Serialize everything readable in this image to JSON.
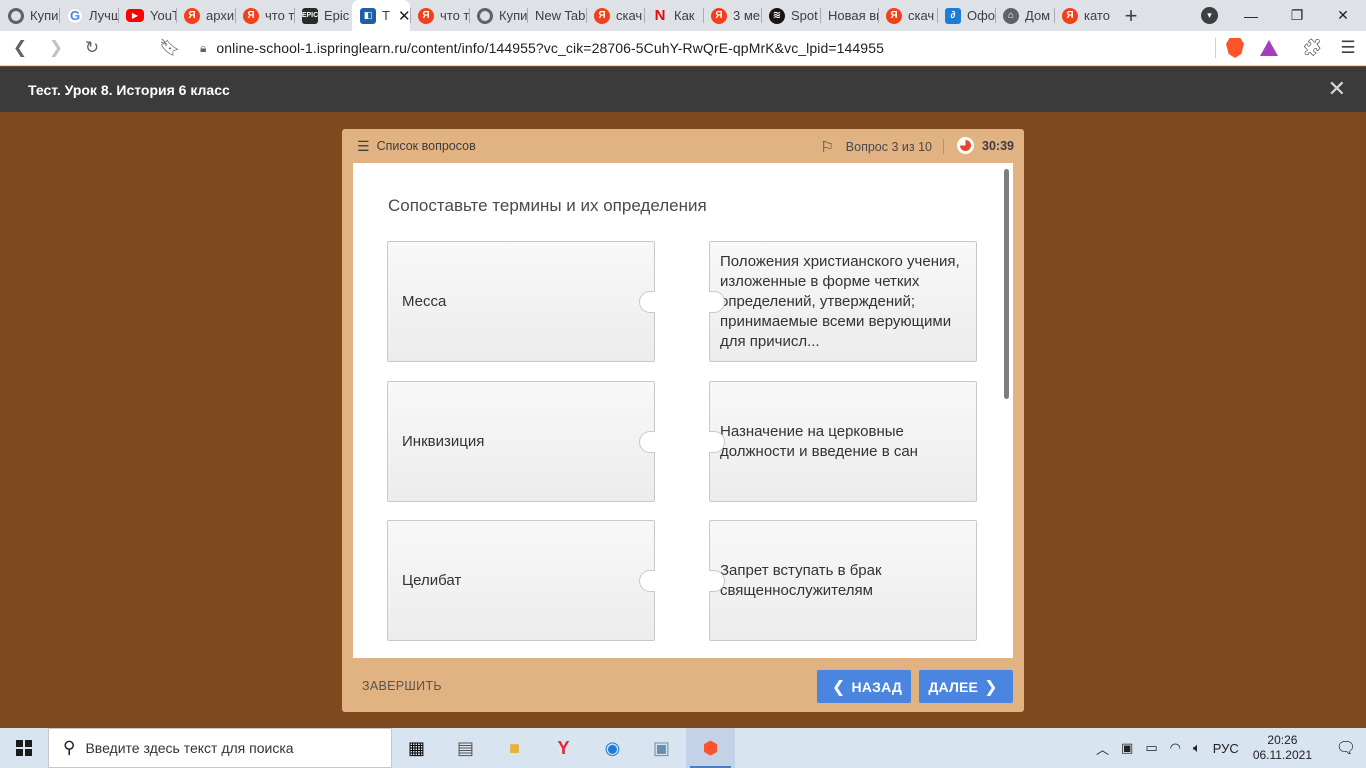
{
  "browser": {
    "tabs": [
      {
        "title": "Купи",
        "icon": "ring-icon"
      },
      {
        "title": "Лучш",
        "icon": "google-icon"
      },
      {
        "title": "YouT",
        "icon": "youtube-icon"
      },
      {
        "title": "архи",
        "icon": "yandex-icon"
      },
      {
        "title": "что т",
        "icon": "yandex-icon"
      },
      {
        "title": "Epic",
        "icon": "epic-icon"
      },
      {
        "title": "T",
        "icon": "ispring-icon",
        "active": true
      },
      {
        "title": "что т",
        "icon": "yandex-icon"
      },
      {
        "title": "Купи",
        "icon": "ring-icon"
      },
      {
        "title": "New Tab",
        "icon": ""
      },
      {
        "title": "скач",
        "icon": "yandex-icon"
      },
      {
        "title": "Как",
        "icon": "netflix-icon"
      },
      {
        "title": "3 ме",
        "icon": "yandex-icon"
      },
      {
        "title": "Spot",
        "icon": "spotify-icon"
      },
      {
        "title": "Новая вк",
        "icon": ""
      },
      {
        "title": "скач",
        "icon": "yandex-icon"
      },
      {
        "title": "Офо",
        "icon": "office-icon"
      },
      {
        "title": "Дом",
        "icon": "home-icon"
      },
      {
        "title": "като",
        "icon": "yandex-icon"
      }
    ],
    "url": "online-school-1.ispringlearn.ru/content/info/144955?vc_cik=28706-5CuhY-RwQrE-qpMrK&vc_lpid=144955"
  },
  "course": {
    "title": "Тест. Урок 8. История 6 класс"
  },
  "quiz": {
    "question_list_label": "Список вопросов",
    "counter": "Вопрос 3 из 10",
    "timer": "30:39",
    "prompt": "Сопоставьте термины и их определения",
    "terms": [
      "Месса",
      "Инквизиция",
      "Целибат"
    ],
    "definitions": [
      "Положения христианского учения, изложенные в форме четких определений, утверждений; принимаемые всеми верующими для причисл...",
      "Назначение на церковные должности и введение в сан",
      "Запрет вступать в брак священнослужителям"
    ],
    "finish_label": "ЗАВЕРШИТЬ",
    "back_label": "НАЗАД",
    "next_label": "ДАЛЕЕ"
  },
  "taskbar": {
    "search_placeholder": "Введите здесь текст для поиска",
    "language": "РУС",
    "time": "20:26",
    "date": "06.11.2021"
  },
  "colors": {
    "page_bg": "#7f4a1f",
    "panel_bg": "#e1b282",
    "header_bg": "#3b3b3b",
    "button_blue": "#4a86e0"
  }
}
